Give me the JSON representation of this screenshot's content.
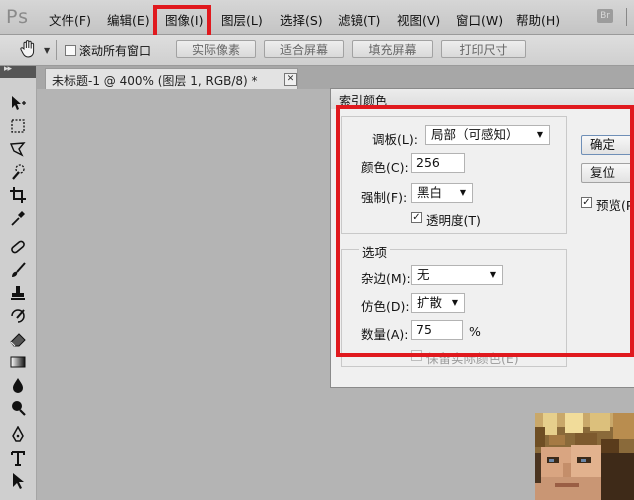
{
  "app": {
    "logo": "Ps",
    "bridge_badge": "Br"
  },
  "menu": {
    "items": [
      "文件(F)",
      "编辑(E)",
      "图像(I)",
      "图层(L)",
      "选择(S)",
      "滤镜(T)",
      "视图(V)",
      "窗口(W)",
      "帮助(H)"
    ],
    "highlighted_item": "图像(I)"
  },
  "options_bar": {
    "tool_icon": "hand-icon",
    "scroll_all_windows_label": "滚动所有窗口",
    "scroll_all_windows_checked": false,
    "buttons": [
      "实际像素",
      "适合屏幕",
      "填充屏幕",
      "打印尺寸"
    ]
  },
  "toolbox": {
    "tools": [
      "move-icon",
      "marquee-icon",
      "lasso-icon",
      "quick-select-icon",
      "crop-icon",
      "eyedropper-icon",
      "healing-brush-icon",
      "brush-icon",
      "clone-stamp-icon",
      "history-brush-icon",
      "eraser-icon",
      "gradient-icon",
      "blur-icon",
      "dodge-icon",
      "pen-icon",
      "type-icon",
      "path-select-icon"
    ]
  },
  "document": {
    "tab_title": "未标题-1 @ 400% (图层 1, RGB/8) *",
    "close_glyph": "✕"
  },
  "dialog": {
    "title": "索引颜色",
    "palette_label": "调板(L):",
    "palette_value": "局部（可感知）",
    "colors_label": "颜色(C):",
    "colors_value": "256",
    "forced_label": "强制(F):",
    "forced_value": "黑白",
    "transparency_label": "透明度(T)",
    "transparency_checked": true,
    "options_caption": "选项",
    "matte_label": "杂边(M):",
    "matte_value": "无",
    "dither_label": "仿色(D):",
    "dither_value": "扩散",
    "amount_label": "数量(A):",
    "amount_value": "75",
    "amount_unit": "%",
    "preserve_label": "保留实际颜色(E)",
    "preserve_checked": false,
    "ok_label": "确定",
    "reset_label": "复位",
    "preview_label": "预览(P)",
    "preview_checked": true
  },
  "colors": {
    "highlight": "#e0191e",
    "menubar_bg": "#cccccc",
    "canvas_bg": "#b4b4b4",
    "dialog_bg": "#f0f0f0"
  }
}
